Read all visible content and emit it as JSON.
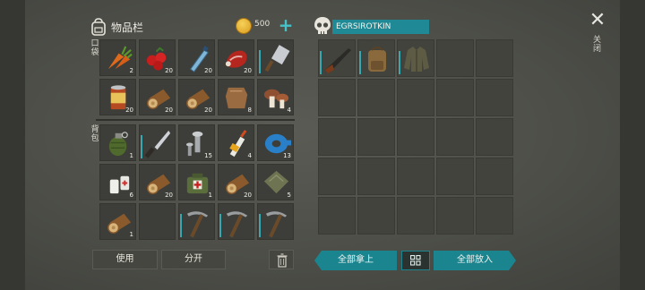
{
  "inventory": {
    "title": "物品栏",
    "coins": "500",
    "pocket_label": "口袋",
    "backpack_label": "背包",
    "pocket": [
      {
        "item": "carrot",
        "qty": "2"
      },
      {
        "item": "berries",
        "qty": "20"
      },
      {
        "item": "water-bottle",
        "qty": "20"
      },
      {
        "item": "raw-meat",
        "qty": "20"
      },
      {
        "item": "cleaver",
        "qty": ""
      },
      {
        "item": "canned-food",
        "qty": "20"
      },
      {
        "item": "log",
        "qty": "20"
      },
      {
        "item": "log",
        "qty": "20"
      },
      {
        "item": "leather",
        "qty": "8"
      },
      {
        "item": "mushrooms",
        "qty": "4"
      }
    ],
    "backpack": [
      {
        "item": "grenade",
        "qty": "1"
      },
      {
        "item": "machete",
        "qty": ""
      },
      {
        "item": "screws",
        "qty": "15"
      },
      {
        "item": "glue",
        "qty": "4"
      },
      {
        "item": "duct-tape",
        "qty": "13"
      },
      {
        "item": "pills",
        "qty": "6"
      },
      {
        "item": "log",
        "qty": "20"
      },
      {
        "item": "medkit-bag",
        "qty": "1"
      },
      {
        "item": "log",
        "qty": "20"
      },
      {
        "item": "cloth",
        "qty": "5"
      },
      {
        "item": "log",
        "qty": "1"
      },
      {
        "item": "",
        "qty": ""
      },
      {
        "item": "pickaxe",
        "qty": ""
      },
      {
        "item": "pickaxe",
        "qty": ""
      },
      {
        "item": "pickaxe",
        "qty": ""
      }
    ]
  },
  "loot": {
    "player_name": "EGRSIROTKIN",
    "items": [
      {
        "item": "rifle"
      },
      {
        "item": "backpack"
      },
      {
        "item": "jacket"
      }
    ]
  },
  "actions": {
    "close_label": "关闭",
    "use_label": "使用",
    "split_label": "分开",
    "take_all_label": "全部拿上",
    "put_all_label": "全部放入"
  }
}
